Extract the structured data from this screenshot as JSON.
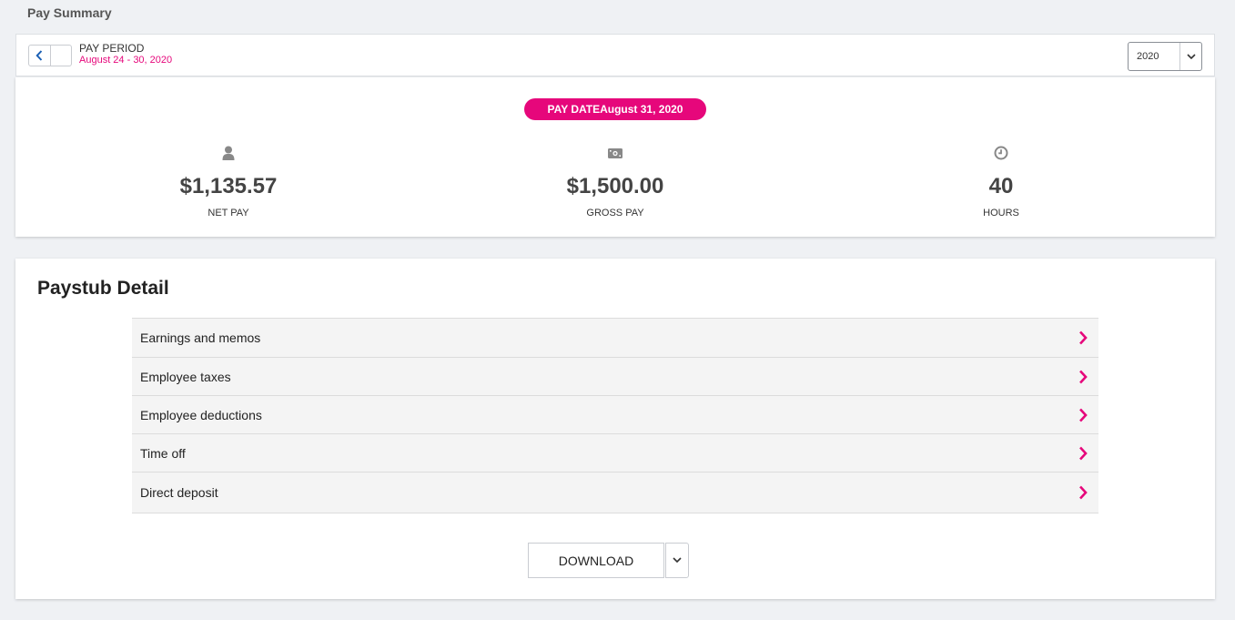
{
  "page": {
    "title": "Pay Summary"
  },
  "period": {
    "label": "PAY PERIOD",
    "range": "August 24 - 30, 2020",
    "year": "2020",
    "prev_icon": "chevron-left-icon",
    "next_icon": "chevron-right-icon"
  },
  "summary": {
    "pay_date_label": "PAY DATE",
    "pay_date": "August 31, 2020",
    "metrics": [
      {
        "icon": "person-icon",
        "value": "$1,135.57",
        "label": "NET PAY"
      },
      {
        "icon": "cash-icon",
        "value": "$1,500.00",
        "label": "GROSS PAY"
      },
      {
        "icon": "clock-icon",
        "value": "40",
        "label": "HOURS"
      }
    ]
  },
  "detail": {
    "title": "Paystub Detail",
    "rows": [
      {
        "label": "Earnings and memos"
      },
      {
        "label": "Employee taxes"
      },
      {
        "label": "Employee deductions"
      },
      {
        "label": "Time off"
      },
      {
        "label": "Direct deposit"
      }
    ],
    "download_label": "DOWNLOAD"
  },
  "colors": {
    "accent": "#e6077b",
    "nav_blue": "#1a5fb4",
    "background": "#eff1f4"
  }
}
